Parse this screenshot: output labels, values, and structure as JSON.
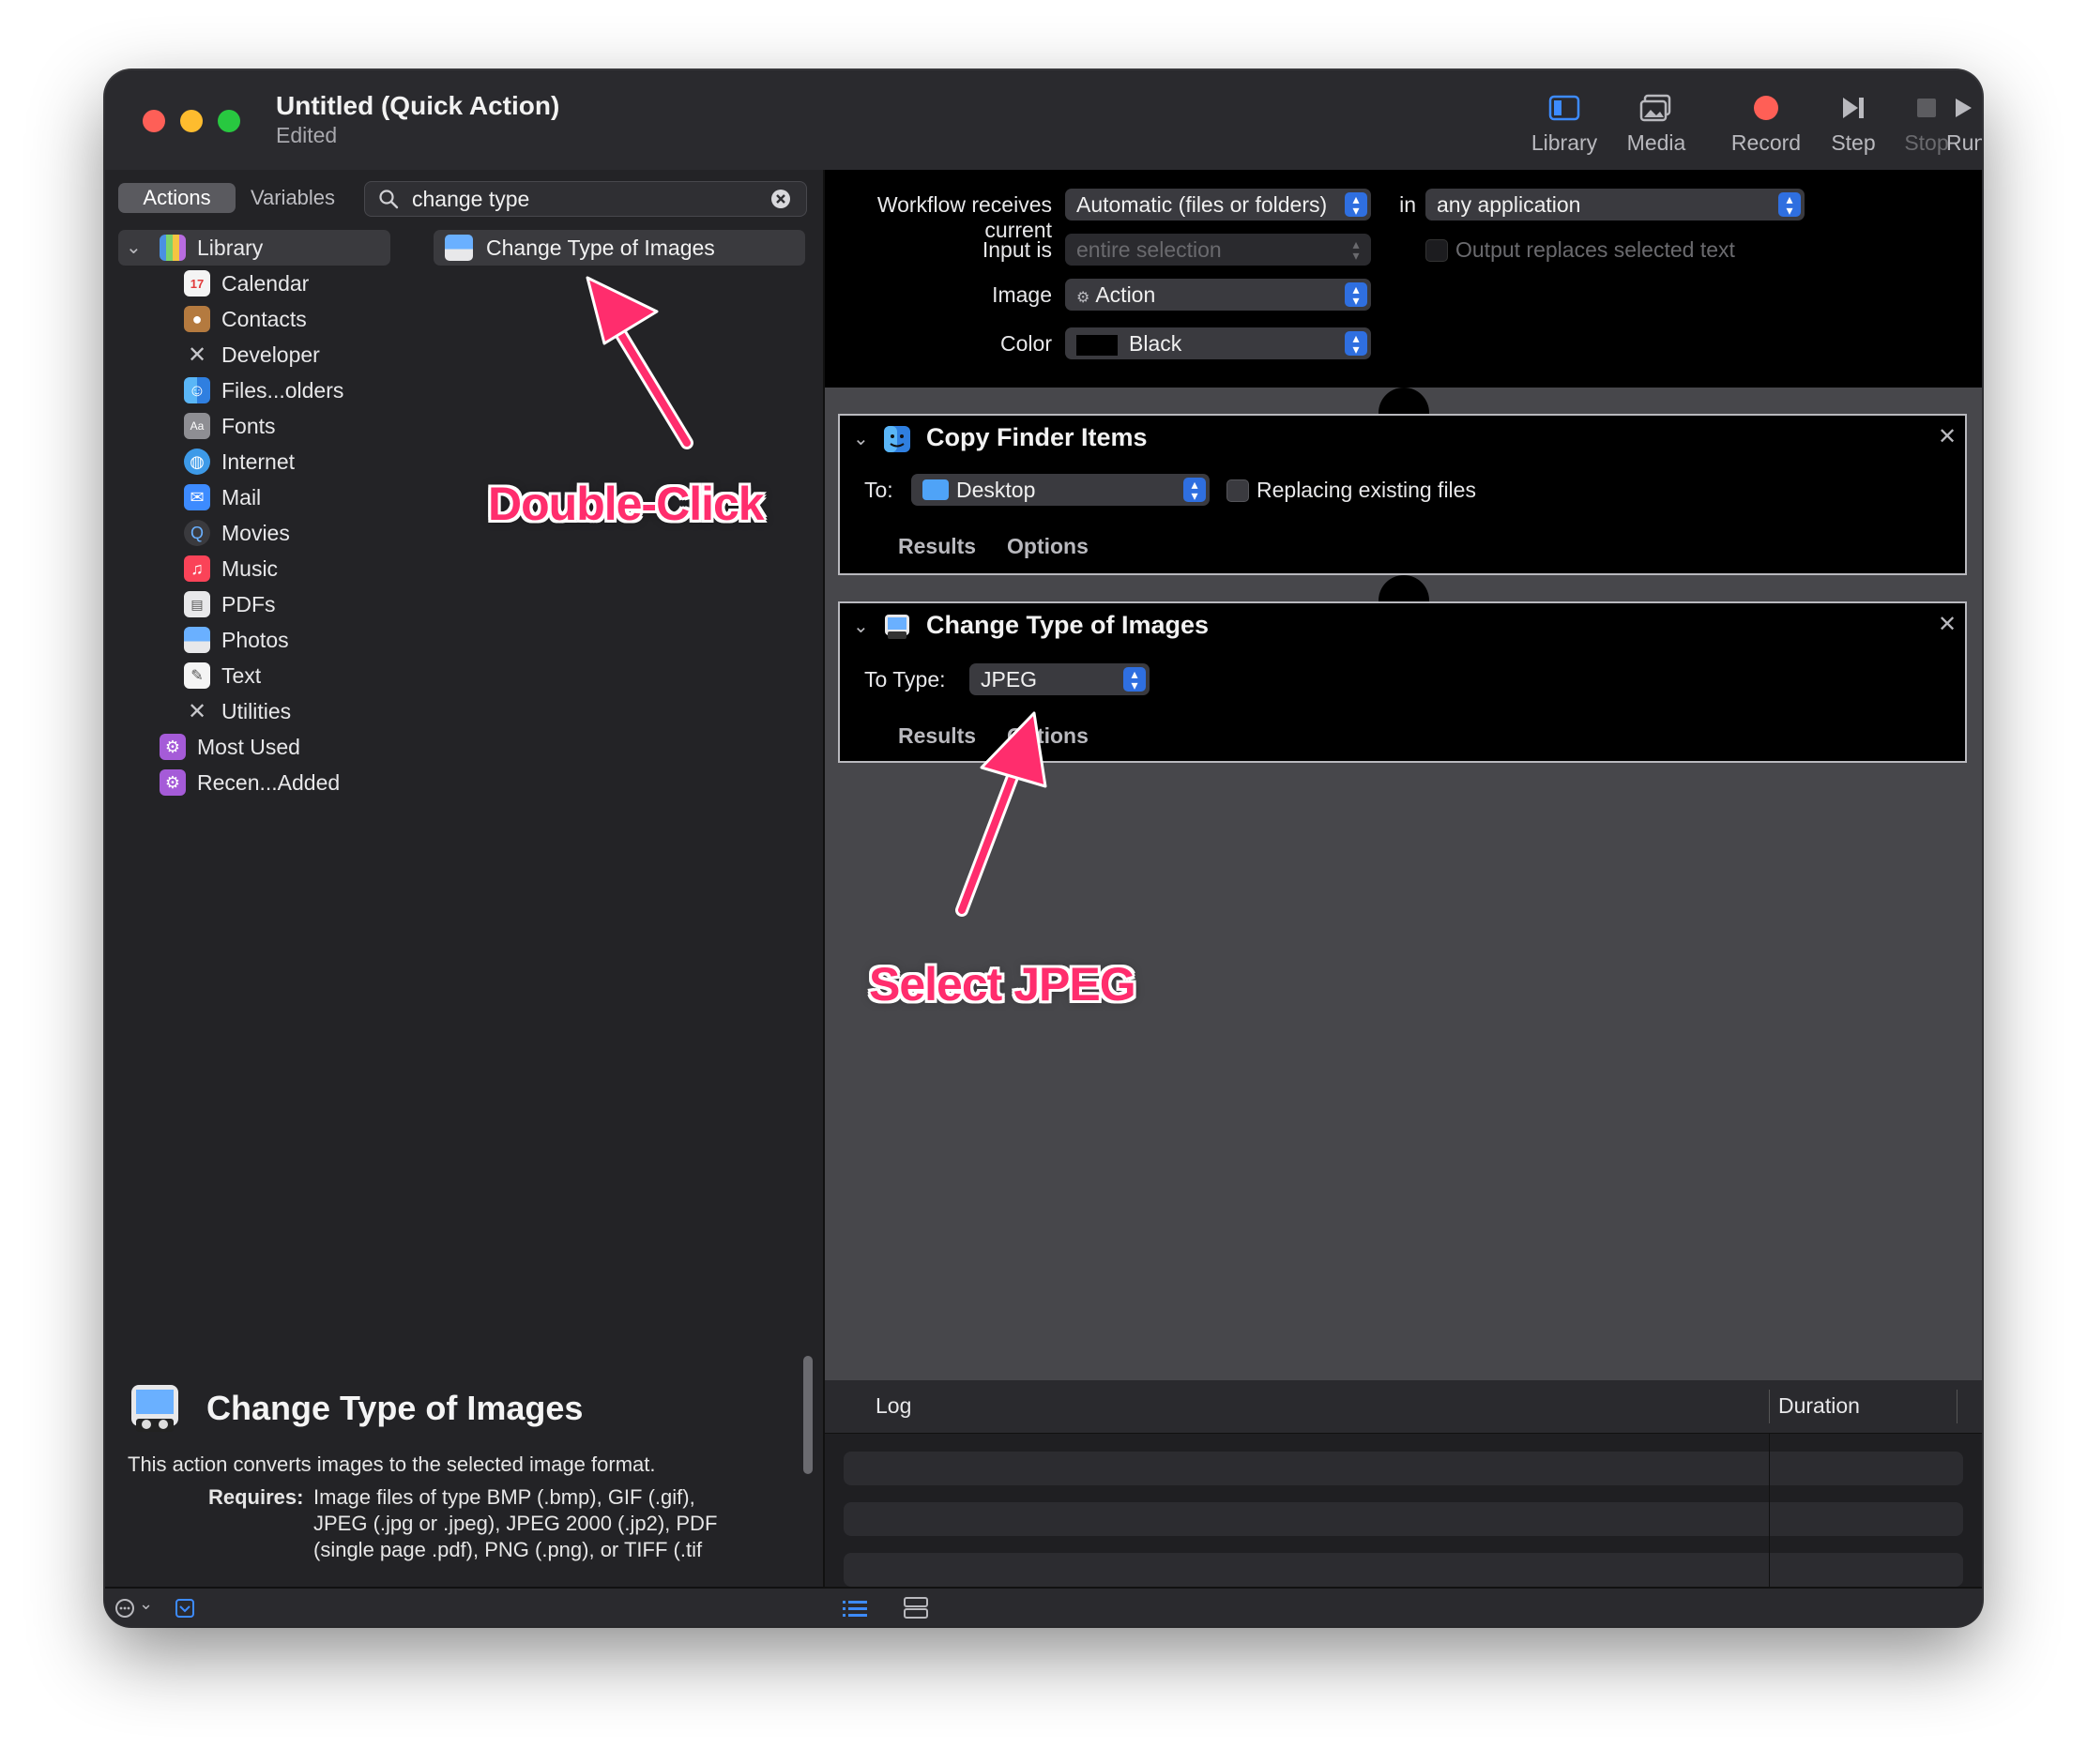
{
  "window": {
    "title": "Untitled (Quick Action)",
    "subtitle": "Edited"
  },
  "toolbar": {
    "library": "Library",
    "media": "Media",
    "record": "Record",
    "step": "Step",
    "stop": "Stop",
    "run": "Run"
  },
  "left": {
    "tab_actions": "Actions",
    "tab_variables": "Variables",
    "search_value": "change type",
    "library_root": "Library",
    "library_items": [
      "Calendar",
      "Contacts",
      "Developer",
      "Files...olders",
      "Fonts",
      "Internet",
      "Mail",
      "Movies",
      "Music",
      "PDFs",
      "Photos",
      "Text",
      "Utilities"
    ],
    "extra_items": [
      "Most Used",
      "Recen...Added"
    ],
    "result_item": "Change Type of Images"
  },
  "description": {
    "title": "Change Type of Images",
    "text": "This action converts images to the selected image format.",
    "requires_label": "Requires:",
    "requires_lines": [
      "Image files of type BMP (.bmp), GIF (.gif),",
      "JPEG (.jpg or .jpeg), JPEG 2000 (.jp2), PDF",
      "(single page .pdf), PNG (.png), or TIFF (.tif"
    ]
  },
  "workflow": {
    "receives_label": "Workflow receives current",
    "receives_value": "Automatic (files or folders)",
    "in_label": "in",
    "app_value": "any application",
    "input_label": "Input is",
    "input_value": "entire selection",
    "output_replaces": "Output replaces selected text",
    "image_label": "Image",
    "image_value": "Action",
    "color_label": "Color",
    "color_value": "Black"
  },
  "action1": {
    "title": "Copy Finder Items",
    "to_label": "To:",
    "to_value": "Desktop",
    "replacing": "Replacing existing files",
    "results": "Results",
    "options": "Options"
  },
  "action2": {
    "title": "Change Type of Images",
    "type_label": "To Type:",
    "type_value": "JPEG",
    "results": "Results",
    "options": "Options"
  },
  "log": {
    "col_log": "Log",
    "col_duration": "Duration"
  },
  "annotations": {
    "double_click": "Double-Click",
    "select_jpeg": "Select JPEG"
  },
  "colors": {
    "accent_blue": "#2f6fe0",
    "annotation_pink": "#ff2d6d",
    "record_red": "#ff5f56"
  }
}
